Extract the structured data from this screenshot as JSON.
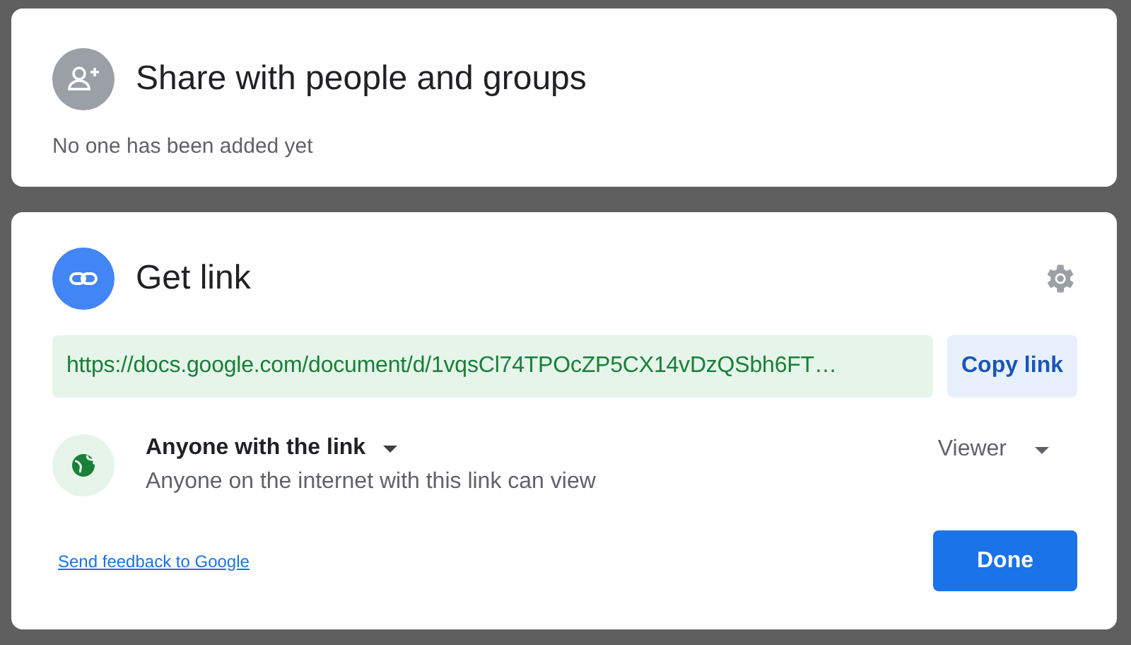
{
  "share": {
    "title": "Share with people and groups",
    "empty_note": "No one has been added yet"
  },
  "get_link": {
    "title": "Get link",
    "url": "https://docs.google.com/document/d/1vqsCl74TPOcZP5CX14vDzQSbh6FT…",
    "copy_button": "Copy link",
    "access": {
      "scope": "Anyone with the link",
      "description": "Anyone on the internet with this link can view",
      "role": "Viewer"
    },
    "feedback_link": "Send feedback to Google",
    "done_button": "Done"
  }
}
